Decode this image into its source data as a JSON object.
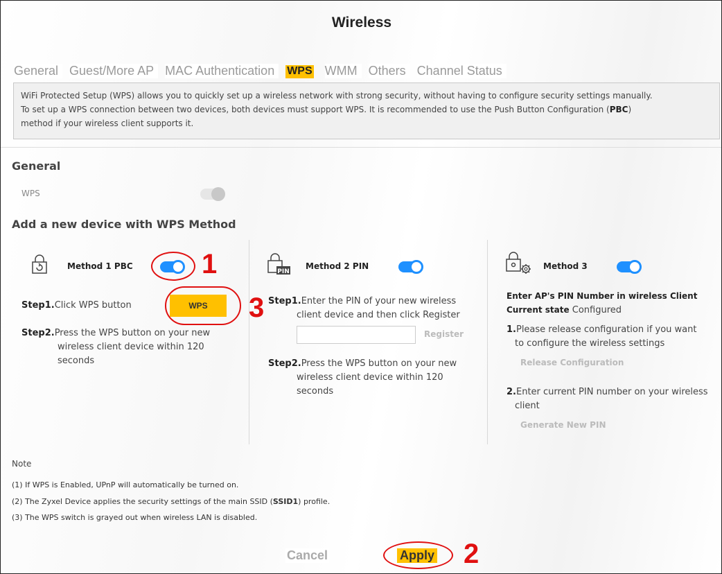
{
  "title": "Wireless",
  "tabs": [
    {
      "label": "General"
    },
    {
      "label": "Guest/More AP"
    },
    {
      "label": "MAC Authentication"
    },
    {
      "label": "WPS"
    },
    {
      "label": "WMM"
    },
    {
      "label": "Others"
    },
    {
      "label": "Channel Status"
    }
  ],
  "active_tab": "WPS",
  "description": {
    "line1": "WiFi Protected Setup (WPS) allows you to quickly set up a wireless network with strong security, without having to configure security settings manually.",
    "line2a": "To set up a WPS connection between two devices, both devices must support WPS. It is recommended to use the Push Button Configuration (",
    "line2b": "PBC",
    "line2c": ")",
    "line3": "method if your wireless client supports it."
  },
  "general": {
    "heading": "General",
    "wps_label": "WPS",
    "wps_enabled": false
  },
  "add_device": {
    "heading": "Add a new device with WPS Method"
  },
  "method1": {
    "title": "Method 1 PBC",
    "enabled": true,
    "step1_label": "Step1.",
    "step1_text": "Click WPS button",
    "wps_button": "WPS",
    "step2_label": "Step2.",
    "step2_line1": "Press the WPS button on your new",
    "step2_line2": "wireless client device within 120",
    "step2_line3": "seconds"
  },
  "method2": {
    "title": "Method 2 PIN",
    "icon_text": "PIN",
    "enabled": true,
    "step1_label": "Step1.",
    "step1_line1": "Enter the PIN of your new wireless",
    "step1_line2": "client device and then click Register",
    "pin_value": "",
    "register_button": "Register",
    "step2_label": "Step2.",
    "step2_line1": "Press the WPS button on your new",
    "step2_line2": "wireless client device within 120",
    "step2_line3": "seconds"
  },
  "method3": {
    "title": "Method 3",
    "enabled": true,
    "heading_line1": "Enter AP's PIN Number in wireless Client",
    "state_label": "Current state",
    "state_value": "Configured",
    "item1_num": "1.",
    "item1_line1": "Please release configuration if you want",
    "item1_line2": "to configure the wireless settings",
    "release_button": "Release Configuration",
    "item2_num": "2.",
    "item2_line1": "Enter current PIN number on your wireless",
    "item2_line2": "client",
    "generate_button": "Generate New PIN"
  },
  "note": {
    "title": "Note",
    "line1": "(1) If WPS is Enabled, UPnP will automatically be turned on.",
    "line2a": "(2) The Zyxel Device applies the security settings of the main SSID (",
    "line2b": "SSID1",
    "line2c": ") profile.",
    "line3": "(3) The WPS switch is grayed out when wireless LAN is disabled."
  },
  "buttons": {
    "cancel": "Cancel",
    "apply": "Apply"
  },
  "annotations": [
    "1",
    "2",
    "3"
  ],
  "colors": {
    "accent": "#ffc000",
    "toggle_on": "#1e90ff",
    "annotation": "#e01010"
  }
}
